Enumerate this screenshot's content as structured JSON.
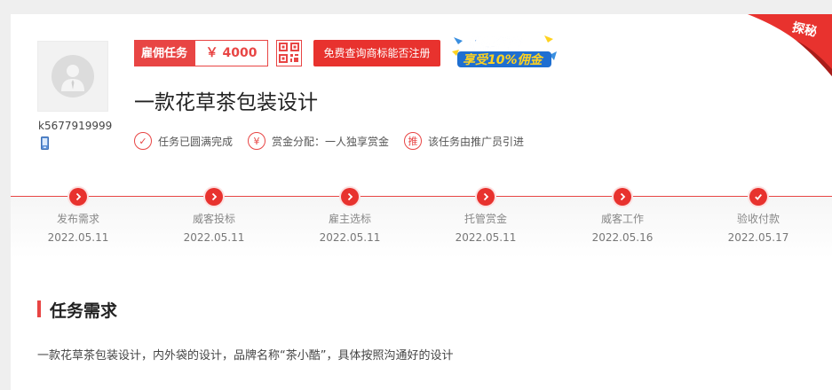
{
  "user": {
    "username": "k5677919999"
  },
  "reward": {
    "label": "雇佣任务",
    "price": "￥ 4000"
  },
  "actions": {
    "check_trademark": "免费查询商标能否注册"
  },
  "promo": {
    "line1": "推荐任务",
    "line2": "享受10%佣金"
  },
  "corner": {
    "label": "探秘"
  },
  "task": {
    "title": "一款花草茶包装设计"
  },
  "features": [
    {
      "icon": "check-circle-icon",
      "glyph": "✓",
      "label": "任务已圆满完成"
    },
    {
      "icon": "yen-circle-icon",
      "glyph": "¥",
      "label": "赏金分配：一人独享赏金"
    },
    {
      "icon": "recommend-circle-icon",
      "glyph": "推",
      "label": "该任务由推广员引进"
    }
  ],
  "timeline": [
    {
      "name": "发布需求",
      "date": "2022.05.11",
      "icon": "chevron-right-icon"
    },
    {
      "name": "威客投标",
      "date": "2022.05.11",
      "icon": "chevron-right-icon"
    },
    {
      "name": "雇主选标",
      "date": "2022.05.11",
      "icon": "chevron-right-icon"
    },
    {
      "name": "托管赏金",
      "date": "2022.05.11",
      "icon": "chevron-right-icon"
    },
    {
      "name": "威客工作",
      "date": "2022.05.16",
      "icon": "chevron-right-icon"
    },
    {
      "name": "验收付款",
      "date": "2022.05.17",
      "icon": "check-icon"
    }
  ],
  "requirements": {
    "heading": "任务需求",
    "text": "一款花草茶包装设计，内外袋的设计，品牌名称“茶小酷”，具体按照沟通好的设计"
  },
  "colors": {
    "accent": "#e84544",
    "button": "#e8322e",
    "promo_blue": "#1f6fd1",
    "promo_yellow": "#ffd21f"
  }
}
